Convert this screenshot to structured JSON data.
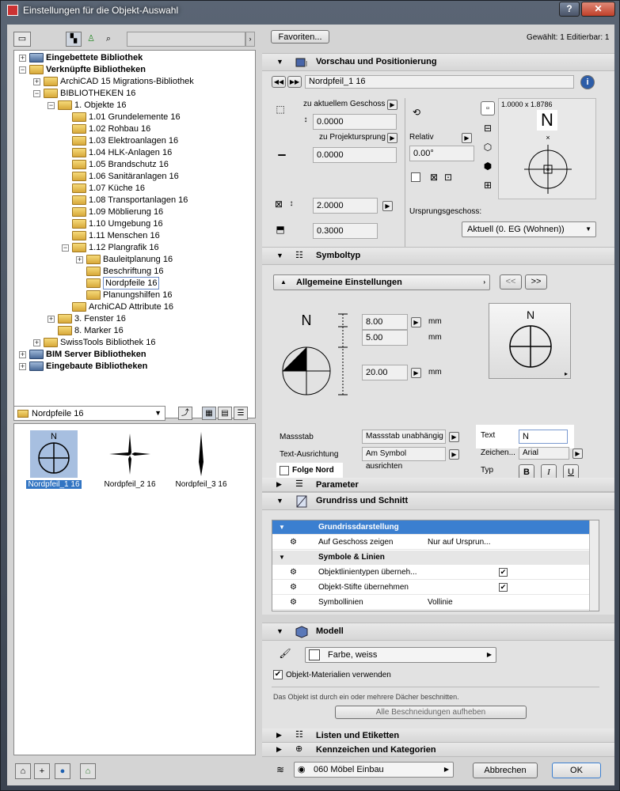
{
  "window": {
    "title": "Einstellungen für die Objekt-Auswahl",
    "help_label": "?",
    "close_label": "✕"
  },
  "left": {
    "tree": [
      {
        "label": "Eingebettete Bibliothek",
        "bold": true,
        "depth": 0,
        "type": "lib",
        "exp": "+"
      },
      {
        "label": "Verknüpfte Bibliotheken",
        "bold": true,
        "depth": 0,
        "type": "folder",
        "exp": "−"
      },
      {
        "label": "ArchiCAD 15 Migrations-Bibliothek",
        "depth": 1,
        "type": "folder",
        "exp": "+"
      },
      {
        "label": "BIBLIOTHEKEN 16",
        "depth": 1,
        "type": "folder",
        "exp": "−",
        "hl": true
      },
      {
        "label": "1. Objekte 16",
        "depth": 2,
        "type": "folder",
        "exp": "−"
      },
      {
        "label": "1.01 Grundelemente 16",
        "depth": 3,
        "type": "folder"
      },
      {
        "label": "1.02 Rohbau 16",
        "depth": 3,
        "type": "folder"
      },
      {
        "label": "1.03 Elektroanlagen 16",
        "depth": 3,
        "type": "folder"
      },
      {
        "label": "1.04 HLK-Anlagen 16",
        "depth": 3,
        "type": "folder"
      },
      {
        "label": "1.05 Brandschutz 16",
        "depth": 3,
        "type": "folder"
      },
      {
        "label": "1.06 Sanitäranlagen 16",
        "depth": 3,
        "type": "folder"
      },
      {
        "label": "1.07 Küche 16",
        "depth": 3,
        "type": "folder"
      },
      {
        "label": "1.08 Transportanlagen 16",
        "depth": 3,
        "type": "folder"
      },
      {
        "label": "1.09 Möblierung 16",
        "depth": 3,
        "type": "folder"
      },
      {
        "label": "1.10 Umgebung 16",
        "depth": 3,
        "type": "folder"
      },
      {
        "label": "1.11 Menschen 16",
        "depth": 3,
        "type": "folder"
      },
      {
        "label": "1.12 Plangrafik 16",
        "depth": 3,
        "type": "folder",
        "exp": "−",
        "hl": true
      },
      {
        "label": "Bauleitplanung 16",
        "depth": 4,
        "type": "folder",
        "exp": "+"
      },
      {
        "label": "Beschriftung 16",
        "depth": 4,
        "type": "folder"
      },
      {
        "label": "Nordpfeile 16",
        "depth": 4,
        "type": "folder",
        "sel": true
      },
      {
        "label": "Planungshilfen 16",
        "depth": 4,
        "type": "folder"
      },
      {
        "label": "ArchiCAD Attribute 16",
        "depth": 3,
        "type": "folder"
      },
      {
        "label": "3. Fenster 16",
        "depth": 2,
        "type": "folder",
        "exp": "+"
      },
      {
        "label": "8. Marker 16",
        "depth": 2,
        "type": "folder"
      },
      {
        "label": "SwissTools Bibliothek 16",
        "depth": 1,
        "type": "folder",
        "exp": "+"
      },
      {
        "label": "BIM Server Bibliotheken",
        "bold": true,
        "depth": 0,
        "type": "lib",
        "exp": "+"
      },
      {
        "label": "Eingebaute Bibliotheken",
        "bold": true,
        "depth": 0,
        "type": "lib",
        "exp": "+"
      }
    ],
    "folder_select": "Nordpfeile 16",
    "items": [
      {
        "caption": "Nordpfeil_1 16",
        "selected": true
      },
      {
        "caption": "Nordpfeil_2 16",
        "selected": false
      },
      {
        "caption": "Nordpfeil_3 16",
        "selected": false
      }
    ]
  },
  "top": {
    "favoriten": "Favoriten...",
    "status": "Gewählt: 1 Editierbar: 1"
  },
  "vorschau": {
    "title": "Vorschau und Positionierung",
    "object_name": "Nordpfeil_1 16",
    "geschoss_label": "zu aktuellem Geschoss",
    "geschoss_value": "0.0000",
    "projekt_label": "zu Projektursprung",
    "projekt_value": "0.0000",
    "relativ_label": "Relativ",
    "angle": "0.00°",
    "size_value": "2.0000",
    "height_value": "0.3000",
    "dimensions": "1.0000 x 1.8786",
    "north": "N",
    "ursprung_label": "Ursprungsgeschoss:",
    "ursprung_value": "Aktuell (0. EG (Wohnen))"
  },
  "symboltyp": {
    "title": "Symboltyp",
    "settings_drop": "Allgemeine Einstellungen",
    "nav_prev": "<<",
    "nav_next": ">>",
    "dim1": "8.00",
    "dim2": "5.00",
    "dim3": "20.00",
    "unit": "mm",
    "north": "N",
    "massstab_label": "Massstab",
    "massstab_value": "Massstab unabhängig",
    "ausrichtung_label": "Text-Ausrichtung",
    "ausrichtung_value": "Am Symbol ausrichten",
    "folge_nord": "Folge Nord",
    "text_label": "Text",
    "text_value": "N",
    "zeichen_label": "Zeichen...",
    "zeichen_value": "Arial",
    "typ_label": "Typ",
    "bold": "B",
    "italic": "I",
    "underline": "U"
  },
  "parameter": {
    "title": "Parameter"
  },
  "grundriss": {
    "title": "Grundriss und Schnitt",
    "rows": [
      {
        "kind": "hdr",
        "label": "Grundrissdarstellung",
        "value": ""
      },
      {
        "kind": "row",
        "label": "Auf Geschoss zeigen",
        "value": "Nur auf Ursprun..."
      },
      {
        "kind": "grp",
        "label": "Symbole & Linien",
        "value": ""
      },
      {
        "kind": "row",
        "label": "Objektlinientypen überneh...",
        "value": "",
        "check": "✔"
      },
      {
        "kind": "row",
        "label": "Objekt-Stifte übernehmen",
        "value": "",
        "check": "✔"
      },
      {
        "kind": "row",
        "label": "Symbollinien",
        "value": "Vollinie"
      }
    ]
  },
  "modell": {
    "title": "Modell",
    "material": "Farbe, weiss",
    "materialien_label": "Objekt-Materialien verwenden",
    "note": "Das Objekt ist durch ein oder mehrere Dächer beschnitten.",
    "beschneidungen": "Alle Beschneidungen aufheben"
  },
  "listen": {
    "title": "Listen und Etiketten"
  },
  "kennzeichen": {
    "title": "Kennzeichen und Kategorien"
  },
  "footer": {
    "layer": "060 Möbel Einbau",
    "cancel": "Abbrechen",
    "ok": "OK"
  }
}
